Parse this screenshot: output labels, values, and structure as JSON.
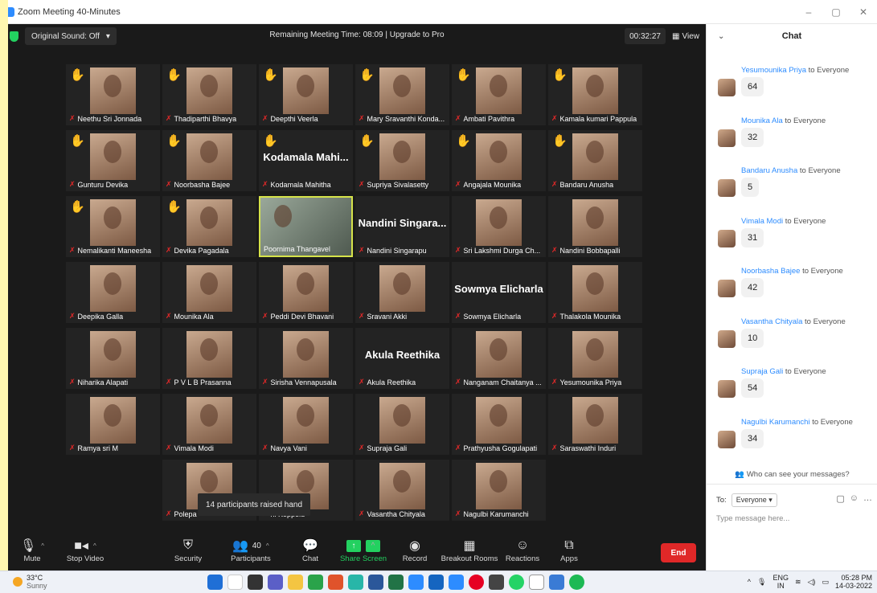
{
  "window": {
    "title": "Zoom Meeting 40-Minutes",
    "controls": [
      "–",
      "▢",
      "✕"
    ]
  },
  "meeting_header": {
    "original_sound": "Original Sound: Off",
    "remaining_time": "Remaining Meeting Time: 08:09 | Upgrade to Pro",
    "timer": "00:32:27",
    "view_label": "View"
  },
  "participants": [
    {
      "name": "Neethu Sri Jonnada",
      "hand": true
    },
    {
      "name": "Thadiparthi Bhavya",
      "hand": true
    },
    {
      "name": "Deepthi Veerla",
      "hand": true
    },
    {
      "name": "Mary Sravanthi Konda...",
      "hand": true
    },
    {
      "name": "Ambati Pavithra",
      "hand": true
    },
    {
      "name": "Kamala kumari Pappula",
      "hand": true
    },
    {
      "name": "Gunturu Devika",
      "hand": true
    },
    {
      "name": "Noorbasha Bajee",
      "hand": true
    },
    {
      "name": "Kodamala Mahitha",
      "hand": true,
      "big_name": "Kodamala Mahi..."
    },
    {
      "name": "Supriya Sivalasetty",
      "hand": true
    },
    {
      "name": "Angajala Mounika",
      "hand": true
    },
    {
      "name": "Bandaru Anusha",
      "hand": true
    },
    {
      "name": "Nemalikanti Maneesha",
      "hand": true
    },
    {
      "name": "Devika Pagadala",
      "hand": true
    },
    {
      "name": "Poornima Thangavel",
      "hand": false,
      "speaker": true
    },
    {
      "name": "Nandini Singarapu",
      "hand": false,
      "big_name": "Nandini Singara..."
    },
    {
      "name": "Sri Lakshmi Durga Ch...",
      "hand": false
    },
    {
      "name": "Nandini Bobbapalli",
      "hand": false
    },
    {
      "name": "Deepika Galla",
      "hand": false
    },
    {
      "name": "Mounika Ala",
      "hand": false
    },
    {
      "name": "Peddi Devi Bhavani",
      "hand": false
    },
    {
      "name": "Sravani Akki",
      "hand": false
    },
    {
      "name": "Sowmya Elicharla",
      "hand": false,
      "big_name": "Sowmya Elicharla"
    },
    {
      "name": "Thalakola Mounika",
      "hand": false
    },
    {
      "name": "Niharika Alapati",
      "hand": false
    },
    {
      "name": "P V L B Prasanna",
      "hand": false
    },
    {
      "name": "Sirisha Vennapusala",
      "hand": false
    },
    {
      "name": "Akula Reethika",
      "hand": false,
      "big_name": "Akula Reethika"
    },
    {
      "name": "Nanganam Chaitanya ...",
      "hand": false
    },
    {
      "name": "Yesumounika Priya",
      "hand": false
    },
    {
      "name": "Ramya sri M",
      "hand": false
    },
    {
      "name": "Vimala Modi",
      "hand": false
    },
    {
      "name": "Navya Vani",
      "hand": false
    },
    {
      "name": "Supraja Gali",
      "hand": false
    },
    {
      "name": "Prathyusha Gogulapati",
      "hand": false
    },
    {
      "name": "Saraswathi Induri",
      "hand": false
    },
    {
      "name": "Polepa",
      "hand": false
    },
    {
      "name": "ni Koppolu",
      "hand": false
    },
    {
      "name": "Vasantha Chityala",
      "hand": false
    },
    {
      "name": "Nagulbi Karumanchi",
      "hand": false
    }
  ],
  "raised_hand_tooltip": "14 participants raised hand",
  "toolbar": {
    "mute": "Mute",
    "stop_video": "Stop Video",
    "security": "Security",
    "participants": "Participants",
    "participants_count": "40",
    "chat": "Chat",
    "share_screen": "Share Screen",
    "record": "Record",
    "breakout_rooms": "Breakout Rooms",
    "reactions": "Reactions",
    "apps": "Apps",
    "end": "End"
  },
  "chat": {
    "title": "Chat",
    "messages": [
      {
        "from": "Yesumounika Priya",
        "to": "to Everyone",
        "text": "64"
      },
      {
        "from": "Mounika Ala",
        "to": "to Everyone",
        "text": "32"
      },
      {
        "from": "Bandaru Anusha",
        "to": "to Everyone",
        "text": "5"
      },
      {
        "from": "Vimala Modi",
        "to": "to Everyone",
        "text": "31"
      },
      {
        "from": "Noorbasha Bajee",
        "to": "to Everyone",
        "text": "42"
      },
      {
        "from": "Vasantha Chityala",
        "to": "to Everyone",
        "text": "10"
      },
      {
        "from": "Supraja Gali",
        "to": "to Everyone",
        "text": "54"
      },
      {
        "from": "Nagulbi Karumanchi",
        "to": "to Everyone",
        "text": "34"
      }
    ],
    "who_can_see": "Who can see your messages?",
    "to_label": "To:",
    "to_value": "Everyone",
    "input_placeholder": "Type message here..."
  },
  "taskbar": {
    "temperature": "33°C",
    "weather": "Sunny",
    "lang": "ENG",
    "lang_sub": "IN",
    "time": "05:28 PM",
    "date": "14-03-2022"
  },
  "colors": {
    "meeting_bg": "#1a1a1a",
    "accent_green": "#23d160",
    "end_red": "#e02828",
    "chat_link": "#2d8cff",
    "hand_yellow": "#f7b500"
  }
}
